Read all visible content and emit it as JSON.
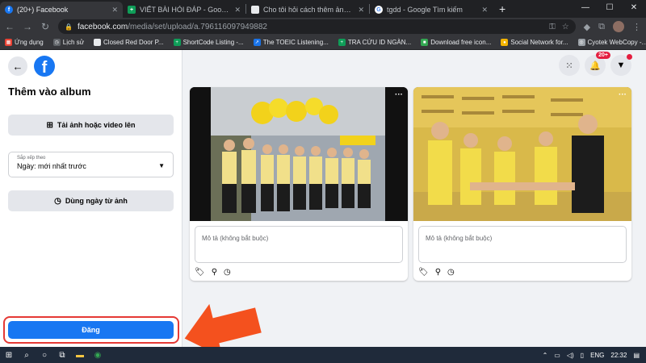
{
  "browser": {
    "tabs": [
      {
        "title": "(20+) Facebook",
        "favicon": "facebook-icon",
        "color": "#1877f2",
        "active": true
      },
      {
        "title": "VIẾT BÀI HỎI ĐÁP - Google Trang tính",
        "favicon": "sheets-icon",
        "color": "#0f9d58",
        "active": false
      },
      {
        "title": "Cho tôi hỏi cách thêm ảnh vào album",
        "favicon": "page-icon",
        "color": "#9aa0a6",
        "active": false
      },
      {
        "title": "tgdd - Google Tìm kiếm",
        "favicon": "google-icon",
        "color": "#4285f4",
        "active": false
      }
    ],
    "new_tab": "+",
    "url_host": "facebook.com",
    "url_path": "/media/set/upload/a.796116097949882",
    "bookmarks": [
      {
        "label": "Ứng dụng",
        "icon": "apps-icon",
        "color": "#ea4335"
      },
      {
        "label": "Lịch sử",
        "icon": "history-icon",
        "color": "#5f6368"
      },
      {
        "label": "Closed Red Door P...",
        "icon": "page-icon",
        "color": "#e8eaed"
      },
      {
        "label": "ShortCode Listing -...",
        "icon": "sheets-icon",
        "color": "#0f9d58"
      },
      {
        "label": "The TOEIC Listening...",
        "icon": "link-icon",
        "color": "#1a73e8"
      },
      {
        "label": "TRA CỨU ID NGÀN...",
        "icon": "sheets-icon",
        "color": "#0f9d58"
      },
      {
        "label": "Download free icon...",
        "icon": "download-icon",
        "color": "#34a853"
      },
      {
        "label": "Social Network for...",
        "icon": "social-icon",
        "color": "#f4b400"
      },
      {
        "label": "Cyotek WebCopy -...",
        "icon": "webcopy-icon",
        "color": "#9aa0a6"
      }
    ]
  },
  "left_panel": {
    "title": "Thêm vào album",
    "upload_label": "Tải ảnh hoặc video lên",
    "sort_label": "Sắp xếp theo",
    "sort_value": "Ngày: mới nhất trước",
    "use_date_label": "Dùng ngày từ ảnh",
    "post_label": "Đăng"
  },
  "header": {
    "notification_count": "20+"
  },
  "photos": [
    {
      "description_placeholder": "Mô tả (không bắt buộc)"
    },
    {
      "description_placeholder": "Mô tả (không bắt buộc)"
    }
  ],
  "taskbar": {
    "language": "ENG",
    "time": "22:32"
  },
  "colors": {
    "facebook_blue": "#1877f2",
    "highlight_red": "#e53935",
    "arrow_orange": "#f4511e"
  }
}
